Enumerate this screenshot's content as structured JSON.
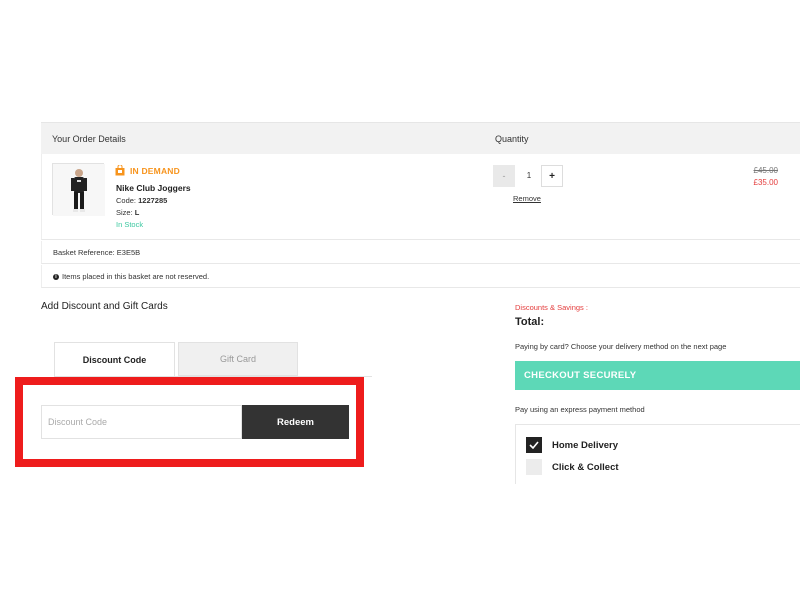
{
  "order": {
    "header_left": "Your Order Details",
    "header_right": "Quantity",
    "item": {
      "badge": "IN DEMAND",
      "name": "Nike Club Joggers",
      "code_label": "Code:",
      "code_value": "1227285",
      "size_label": "Size:",
      "size_value": "L",
      "stock": "In Stock",
      "qty_minus": "-",
      "quantity": "1",
      "qty_plus": "+",
      "remove": "Remove",
      "price_old": "£45.00",
      "price_new": "£35.00"
    },
    "basket_reference": "Basket Reference: E3E5B",
    "reserved_note": "Items placed in this basket are not reserved.",
    "info_icon_text": "i"
  },
  "discount": {
    "title": "Add Discount and Gift Cards",
    "tab_discount": "Discount Code",
    "tab_gift": "Gift Card",
    "input_placeholder": "Discount Code",
    "input_value": "",
    "redeem": "Redeem"
  },
  "summary": {
    "discounts_savings": "Discounts & Savings :",
    "total": "Total:",
    "card_note": "Paying by card? Choose your delivery method on the next page",
    "checkout": "CHECKOUT SECURELY",
    "express_note": "Pay using an express payment method",
    "delivery_options": [
      {
        "label": "Home Delivery",
        "checked": true
      },
      {
        "label": "Click & Collect",
        "checked": false
      }
    ]
  },
  "colors": {
    "demand": "#f7941d",
    "in_stock": "#3cc8a0",
    "sale_price": "#e43c3c",
    "checkout": "#5dd8b7",
    "redeem": "#333333",
    "highlight": "#ee1c1c"
  },
  "icons": {
    "demand": "shopping-bag-icon",
    "info": "info-icon",
    "check": "checkmark-icon"
  }
}
